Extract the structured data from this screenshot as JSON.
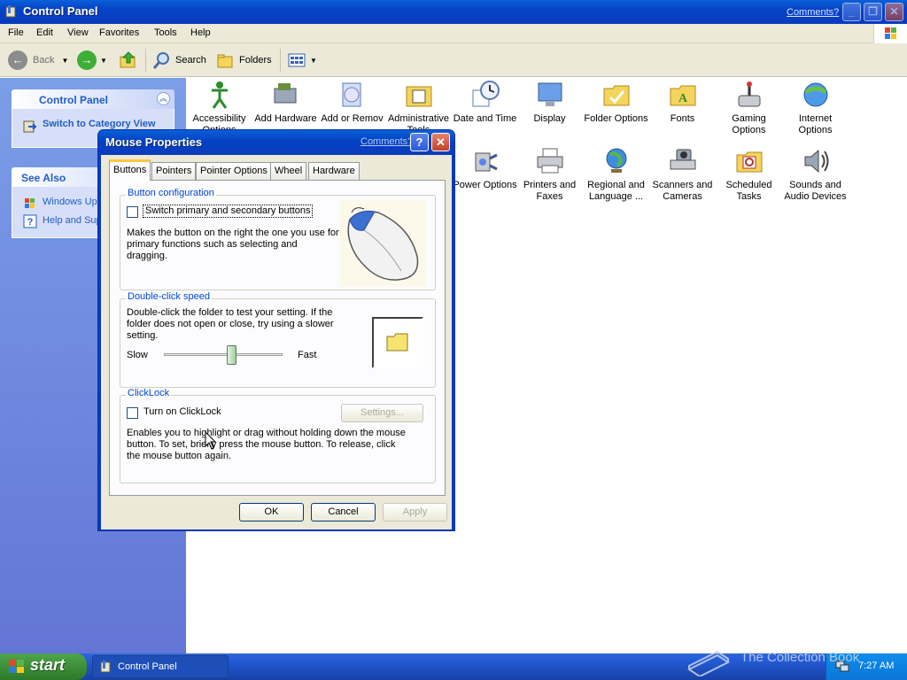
{
  "window": {
    "title": "Control Panel",
    "comments_link": "Comments?"
  },
  "menu": [
    "File",
    "Edit",
    "View",
    "Favorites",
    "Tools",
    "Help"
  ],
  "toolbar": {
    "back": "Back",
    "search": "Search",
    "folders": "Folders"
  },
  "taskpane": {
    "control_panel": {
      "title": "Control Panel",
      "switch_view": "Switch to Category View"
    },
    "see_also": {
      "title": "See Also",
      "items": [
        "Windows Upd",
        "Help and Sup"
      ]
    }
  },
  "items": [
    {
      "label": "Accessibility Options",
      "icon": "accessibility-icon"
    },
    {
      "label": "Add Hardware",
      "icon": "add-hardware-icon"
    },
    {
      "label": "Add or Remov",
      "icon": "add-remove-programs-icon"
    },
    {
      "label": "Administrative Tools",
      "icon": "administrative-tools-icon"
    },
    {
      "label": "Date and Time",
      "icon": "date-time-icon"
    },
    {
      "label": "Display",
      "icon": "display-icon"
    },
    {
      "label": "Folder Options",
      "icon": "folder-options-icon"
    },
    {
      "label": "Fonts",
      "icon": "fonts-icon"
    },
    {
      "label": "Gaming Options",
      "icon": "gaming-options-icon"
    },
    {
      "label": "Internet Options",
      "icon": "internet-options-icon"
    },
    {
      "label": "Power Options",
      "icon": "power-options-icon"
    },
    {
      "label": "Printers and Faxes",
      "icon": "printers-icon"
    },
    {
      "label": "Regional and Language ...",
      "icon": "regional-icon"
    },
    {
      "label": "Scanners and Cameras",
      "icon": "scanners-icon"
    },
    {
      "label": "Scheduled Tasks",
      "icon": "scheduled-tasks-icon"
    },
    {
      "label": "Sounds and Audio Devices",
      "icon": "sounds-icon"
    }
  ],
  "dialog": {
    "title": "Mouse Properties",
    "comments_link": "Comments?",
    "tabs": [
      "Buttons",
      "Pointers",
      "Pointer Options",
      "Wheel",
      "Hardware"
    ],
    "active_tab": "Buttons",
    "button_config": {
      "label": "Button configuration",
      "checkbox": "Switch primary and secondary buttons",
      "checked": false,
      "description": "Makes the button on the right the one you use for primary functions such as selecting and dragging."
    },
    "double_click": {
      "label": "Double-click speed",
      "description": "Double-click the folder to test your setting. If the folder does not open or close, try using a slower setting.",
      "slow": "Slow",
      "fast": "Fast",
      "speed_fraction": 0.58
    },
    "clicklock": {
      "label": "ClickLock",
      "checkbox": "Turn on ClickLock",
      "checked": false,
      "settings_button": "Settings...",
      "description": "Enables you to highlight or drag without holding down the mouse button. To set, briefly press the mouse button. To release, click the mouse button again."
    },
    "buttons": {
      "ok": "OK",
      "cancel": "Cancel",
      "apply": "Apply"
    }
  },
  "taskbar": {
    "start": "start",
    "task": "Control Panel",
    "clock": "7:27 AM"
  },
  "watermark": "The Collection Book"
}
